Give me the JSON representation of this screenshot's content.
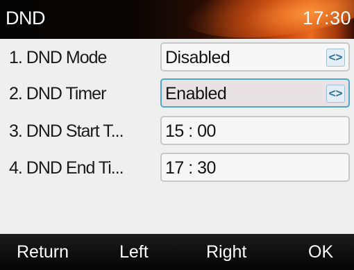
{
  "title_bar": {
    "title": "DND",
    "clock": "17:30"
  },
  "rows": [
    {
      "label": "1. DND Mode",
      "value": "Disabled",
      "has_arrows": true,
      "focused": false
    },
    {
      "label": "2. DND Timer",
      "value": "Enabled",
      "has_arrows": true,
      "focused": true
    },
    {
      "label": "3. DND Start T...",
      "value": "15 : 00",
      "has_arrows": false,
      "focused": false
    },
    {
      "label": "4. DND End Ti...",
      "value": "17 : 30",
      "has_arrows": false,
      "focused": false
    }
  ],
  "arrow_glyph": "<>",
  "softkeys": [
    "Return",
    "Left",
    "Right",
    "OK"
  ],
  "colors": {
    "focus_border": "#4fa6c9",
    "focus_fill": "#e9e2e4",
    "arrow_color": "#2a6f9c",
    "softkey_bg": "#050505",
    "title_accent": "#e8691f"
  }
}
